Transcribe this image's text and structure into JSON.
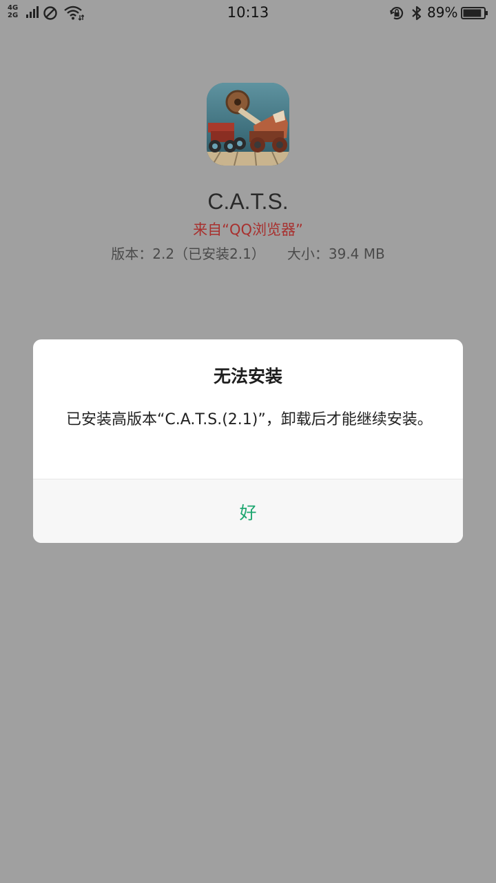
{
  "status_bar": {
    "network_label_top": "4G",
    "network_label_bottom": "2G",
    "time": "10:13",
    "battery_percent": "89%",
    "battery_level": 0.89,
    "icons": [
      "signal-bars-icon",
      "do-not-disturb-icon",
      "wifi-icon",
      "rotation-lock-icon",
      "bluetooth-icon",
      "battery-icon"
    ]
  },
  "app": {
    "name": "C.A.T.S.",
    "source": "来自“QQ浏览器”",
    "version": "版本：2.2（已安装2.1）",
    "size": "大小：39.4 MB"
  },
  "dialog": {
    "title": "无法安装",
    "message": "已安装高版本“C.A.T.S.(2.1)”，卸载后才能继续安装。",
    "ok_label": "好",
    "accent_color": "#1ea770"
  },
  "colors": {
    "overlay": "#a0a0a0",
    "source_text": "#a8302e"
  }
}
